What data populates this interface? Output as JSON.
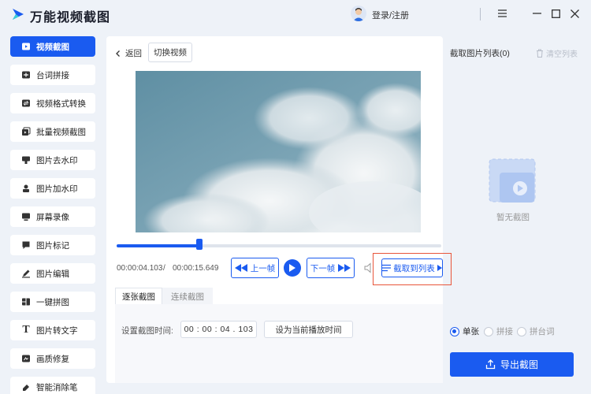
{
  "app": {
    "title": "万能视频截图",
    "login_label": "登录/注册"
  },
  "sidebar": {
    "items": [
      {
        "label": "视频截图",
        "icon": "video-capture-icon",
        "active": true
      },
      {
        "label": "台词拼接",
        "icon": "subtitle-stitch-icon"
      },
      {
        "label": "视频格式转换",
        "icon": "format-convert-icon"
      },
      {
        "label": "批量视频截图",
        "icon": "batch-capture-icon"
      },
      {
        "label": "图片去水印",
        "icon": "remove-watermark-icon"
      },
      {
        "label": "图片加水印",
        "icon": "add-watermark-icon"
      },
      {
        "label": "屏幕录像",
        "icon": "screen-record-icon"
      },
      {
        "label": "图片标记",
        "icon": "image-mark-icon"
      },
      {
        "label": "图片编辑",
        "icon": "image-edit-icon"
      },
      {
        "label": "一键拼图",
        "icon": "collage-icon"
      },
      {
        "label": "图片转文字",
        "icon": "text-icon"
      },
      {
        "label": "画质修复",
        "icon": "quality-repair-icon"
      },
      {
        "label": "智能消除笔",
        "icon": "eraser-icon"
      }
    ]
  },
  "player": {
    "back_label": "返回",
    "switch_label": "切换视频",
    "current_time": "00:00:04.103",
    "separator": "/",
    "total_time": "00:00:15.649",
    "progress": 0.255,
    "prev_frame_label": "上一帧",
    "next_frame_label": "下一帧",
    "capture_to_list_label": "截取到列表"
  },
  "tabs": [
    {
      "label": "逐张截图",
      "active": true
    },
    {
      "label": "连续截图",
      "active": false
    }
  ],
  "capture_settings": {
    "time_label": "设置截图时间:",
    "time_value": "00 : 00 : 04 . 103",
    "set_current_label": "设为当前播放时间"
  },
  "right_panel": {
    "list_title": "截取图片列表(0)",
    "clear_label": "清空列表",
    "empty_text": "暂无截图",
    "modes": [
      {
        "label": "单张",
        "checked": true
      },
      {
        "label": "拼接",
        "checked": false
      },
      {
        "label": "拼台词",
        "checked": false
      }
    ],
    "export_label": "导出截图"
  },
  "colors": {
    "accent": "#1a5bf0",
    "highlight": "#e8553a",
    "bg": "#eef2f8"
  }
}
